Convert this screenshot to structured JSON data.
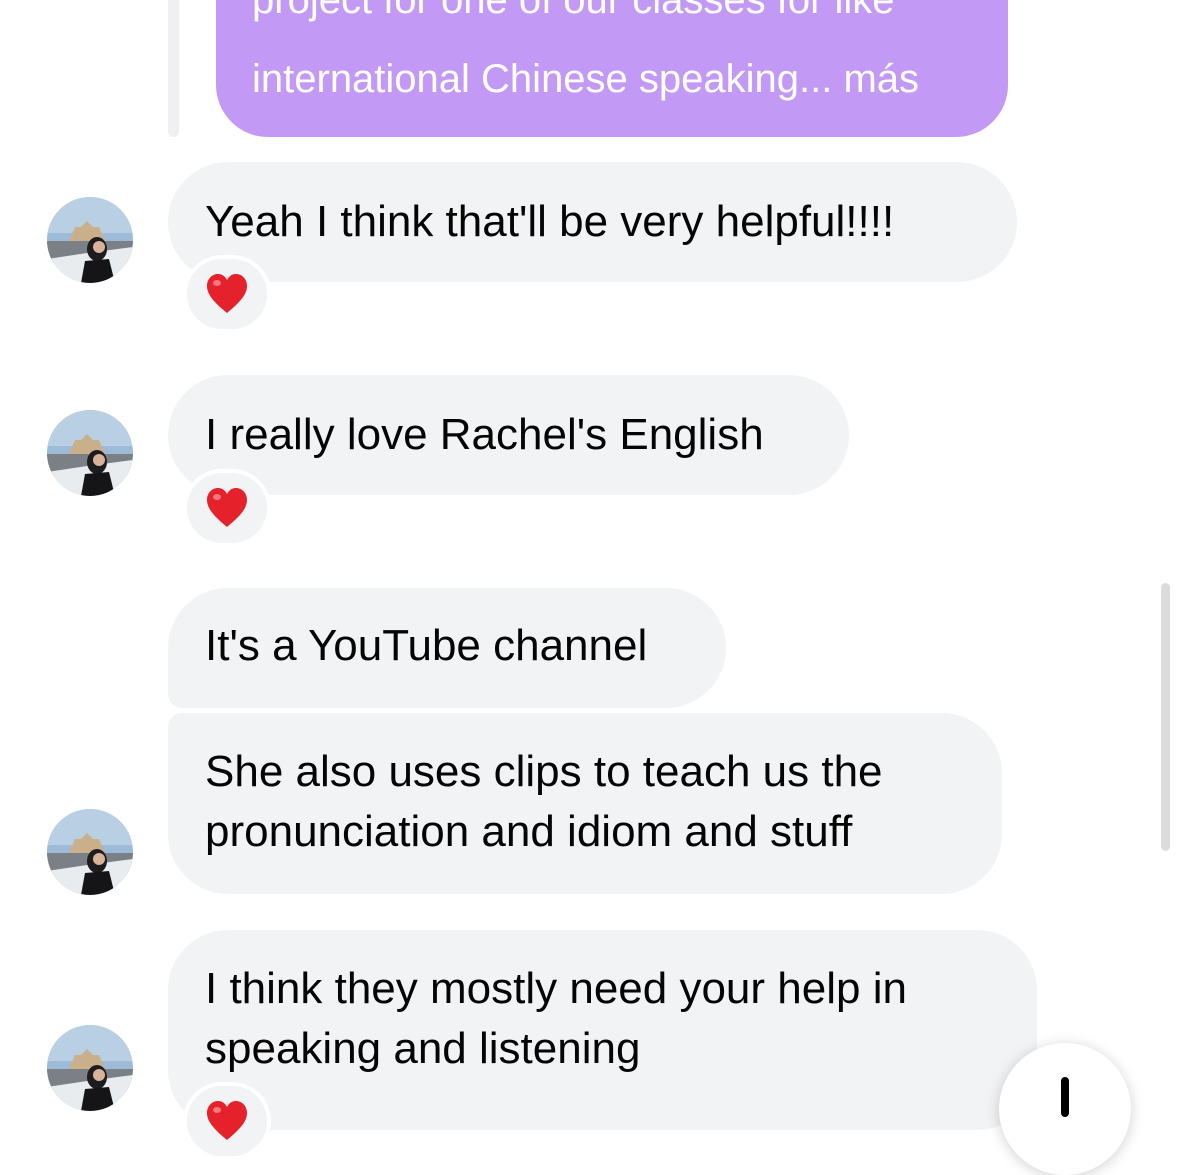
{
  "quoted_message": {
    "line1": "project for one of our classes for like",
    "line2": "international Chinese speaking... más"
  },
  "messages": [
    {
      "lines": [
        "Yeah I think that'll be very helpful!!!!"
      ],
      "reaction": "❤️"
    },
    {
      "lines": [
        "I really love Rachel's English"
      ],
      "reaction": "❤️"
    },
    {
      "lines": [
        "It's a YouTube channel"
      ]
    },
    {
      "lines": [
        "She also uses clips to teach us the",
        "pronunciation and idiom and stuff"
      ]
    },
    {
      "lines": [
        "I think they mostly need your help in",
        "speaking and listening"
      ],
      "reaction": "❤️"
    }
  ],
  "colors": {
    "quoted_bubble": "#c399f6",
    "incoming_bubble": "#f2f3f5",
    "heart": "#e5222c"
  },
  "icons": {
    "reaction": "heart-icon",
    "scroll_button": "arrow-down-icon",
    "avatar": "profile-photo"
  }
}
